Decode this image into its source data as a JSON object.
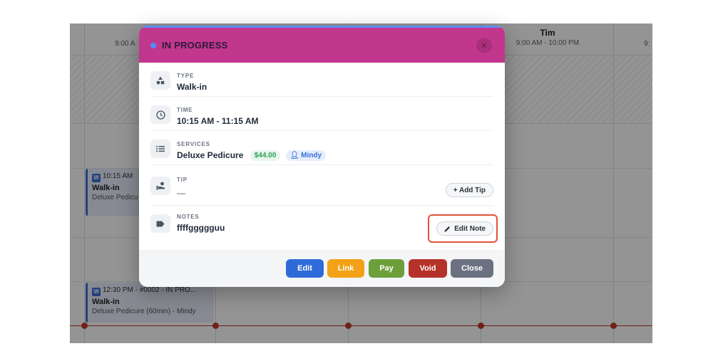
{
  "calendar": {
    "left_hours": "9:00 A",
    "staff": {
      "name": "Tim",
      "hours": "9:00 AM - 10:00 PM"
    },
    "right_hours": "9:",
    "appointments": [
      {
        "time": "10:15 AM",
        "title": "Walk-in",
        "detail": "Deluxe Pedicu",
        "badge": "W"
      },
      {
        "time": "12:30 PM - #0002 - IN PRO...",
        "title": "Walk-in",
        "detail": "Deluxe Pedicure (60min) - Mindy",
        "badge": "W"
      }
    ]
  },
  "modal": {
    "status": "IN PROGRESS",
    "close_icon": "close-icon",
    "fields": {
      "type": {
        "label": "TYPE",
        "value": "Walk-in"
      },
      "time": {
        "label": "TIME",
        "value": "10:15 AM - 11:15 AM"
      },
      "services": {
        "label": "SERVICES",
        "value": "Deluxe Pedicure",
        "price": "$44.00",
        "staff": "Mindy"
      },
      "tip": {
        "label": "TIP",
        "value": "—",
        "action": "+ Add Tip"
      },
      "notes": {
        "label": "NOTES",
        "value": "ffffggggguu",
        "action": "Edit Note"
      }
    },
    "footer": {
      "edit": "Edit",
      "link": "Link",
      "pay": "Pay",
      "void": "Void",
      "close": "Close"
    }
  },
  "colors": {
    "header": "#c2378e",
    "edit": "#2f6bd8",
    "link": "#f2a216",
    "pay": "#6c9f3a",
    "void": "#b5322a",
    "close": "#6b7180",
    "highlight": "#e0533b"
  }
}
